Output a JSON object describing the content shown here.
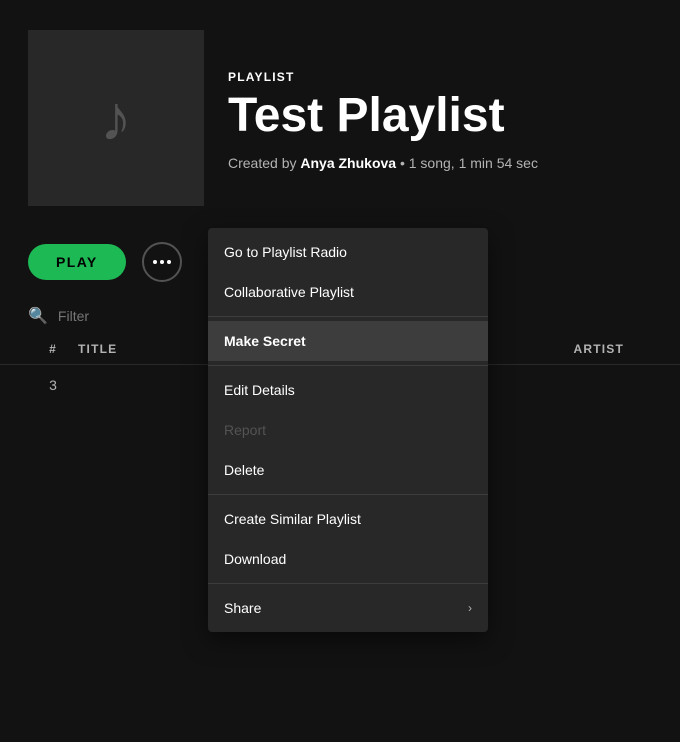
{
  "header": {
    "playlist_label": "PLAYLIST",
    "playlist_title": "Test Playlist",
    "created_by_text": "Created by",
    "creator_name": "Anya Zhukova",
    "meta_info": "• 1 song, 1 min 54 sec"
  },
  "controls": {
    "play_button_label": "PLAY",
    "more_button_label": "..."
  },
  "filter": {
    "placeholder": "Filter"
  },
  "table": {
    "col_number": "#",
    "col_title": "TITLE",
    "col_artist": "ARTIST",
    "track_number": "3"
  },
  "context_menu": {
    "sections": [
      {
        "items": [
          {
            "id": "go-to-radio",
            "label": "Go to Playlist Radio",
            "disabled": false,
            "has_arrow": false
          },
          {
            "id": "collaborative",
            "label": "Collaborative Playlist",
            "disabled": false,
            "has_arrow": false
          }
        ]
      },
      {
        "items": [
          {
            "id": "make-secret",
            "label": "Make Secret",
            "disabled": false,
            "active": true,
            "has_arrow": false
          }
        ]
      },
      {
        "items": [
          {
            "id": "edit-details",
            "label": "Edit Details",
            "disabled": false,
            "has_arrow": false
          },
          {
            "id": "report",
            "label": "Report",
            "disabled": true,
            "has_arrow": false
          },
          {
            "id": "delete",
            "label": "Delete",
            "disabled": false,
            "has_arrow": false
          }
        ]
      },
      {
        "items": [
          {
            "id": "create-similar",
            "label": "Create Similar Playlist",
            "disabled": false,
            "has_arrow": false
          },
          {
            "id": "download",
            "label": "Download",
            "disabled": false,
            "has_arrow": false
          }
        ]
      },
      {
        "items": [
          {
            "id": "share",
            "label": "Share",
            "disabled": false,
            "has_arrow": true
          }
        ]
      }
    ]
  }
}
